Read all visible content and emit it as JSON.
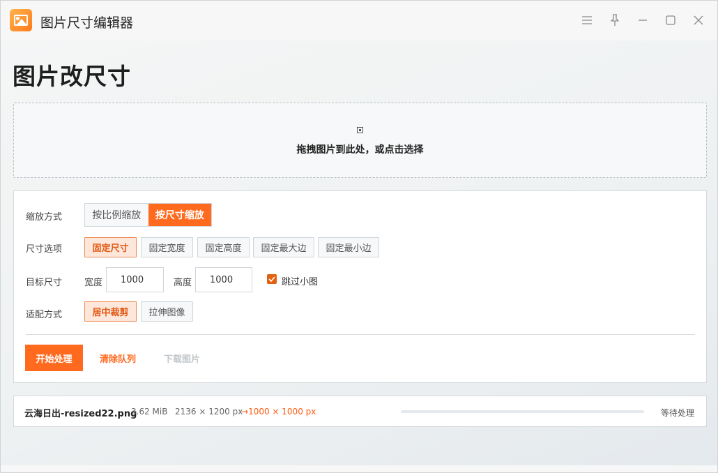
{
  "app": {
    "title": "图片尺寸编辑器"
  },
  "titlebar": {
    "icons": [
      "menu-icon",
      "pin-icon",
      "minimize-icon",
      "maximize-icon",
      "close-icon"
    ]
  },
  "page": {
    "title": "图片改尺寸"
  },
  "dropzone": {
    "text": "拖拽图片到此处，或点击选择"
  },
  "settings": {
    "scale_mode": {
      "label": "缩放方式",
      "options": [
        "按比例缩放",
        "按尺寸缩放"
      ],
      "selected": "按尺寸缩放"
    },
    "size_option": {
      "label": "尺寸选项",
      "options": [
        "固定尺寸",
        "固定宽度",
        "固定高度",
        "固定最大边",
        "固定最小边"
      ],
      "selected": "固定尺寸"
    },
    "target_size": {
      "label": "目标尺寸",
      "width_label": "宽度",
      "width_value": "1000",
      "height_label": "高度",
      "height_value": "1000",
      "skip_small_label": "跳过小图",
      "skip_small_checked": true
    },
    "fit_mode": {
      "label": "适配方式",
      "options": [
        "居中裁剪",
        "拉伸图像"
      ],
      "selected": "居中裁剪"
    }
  },
  "actions": {
    "start": "开始处理",
    "clear": "清除队列",
    "download": "下载图片"
  },
  "queue": {
    "items": [
      {
        "name": "云海日出-resized22.png",
        "size": "3.62 MiB",
        "dimensions": "2136 × 1200 px",
        "arrow": "→",
        "target": "1000 × 1000 px",
        "progress": 0,
        "status": "等待处理"
      }
    ]
  },
  "colors": {
    "accent": "#ff6a1f",
    "accent_light": "#fde7da"
  }
}
